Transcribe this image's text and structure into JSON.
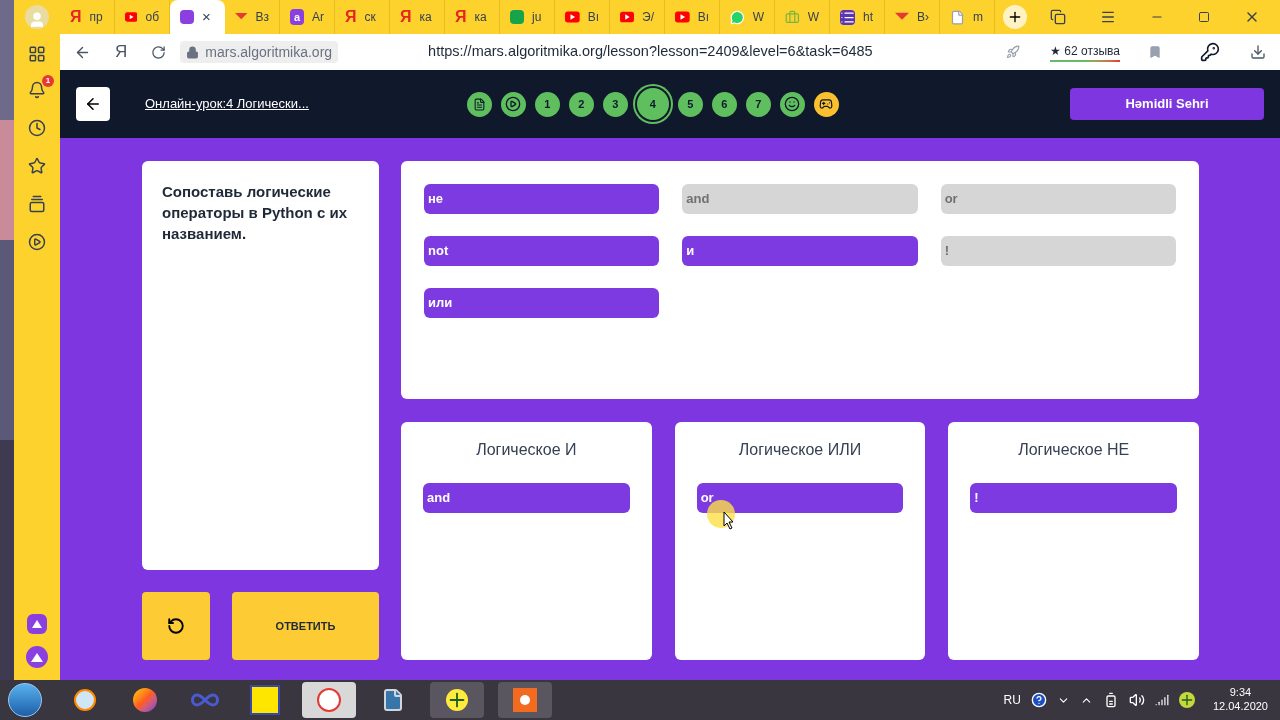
{
  "browser": {
    "tabs": [
      {
        "kind": "yandex",
        "glyph": "Я",
        "title": "пр",
        "selected": false
      },
      {
        "kind": "youtube",
        "title": "об",
        "selected": false
      },
      {
        "kind": "app",
        "selected": true,
        "close": "×"
      },
      {
        "kind": "mail",
        "title": "Вз",
        "selected": false
      },
      {
        "kind": "letter",
        "letter": "a",
        "title": "Ar",
        "selected": false
      },
      {
        "kind": "yandex",
        "glyph": "Я",
        "title": "ск",
        "selected": false
      },
      {
        "kind": "yandex",
        "glyph": "Я",
        "title": "ка",
        "selected": false
      },
      {
        "kind": "yandex",
        "glyph": "Я",
        "title": "ка",
        "selected": false
      },
      {
        "kind": "sheet",
        "title": "ju",
        "selected": false
      },
      {
        "kind": "youtube",
        "title": "Вı",
        "selected": false
      },
      {
        "kind": "youtube",
        "title": "Э/",
        "selected": false
      },
      {
        "kind": "youtube",
        "title": "Вı",
        "selected": false
      },
      {
        "kind": "whatsapp",
        "title": "W",
        "selected": false
      },
      {
        "kind": "briefcase",
        "title": "W",
        "selected": false
      },
      {
        "kind": "list",
        "title": "ht",
        "selected": false
      },
      {
        "kind": "mail",
        "title": "В›",
        "selected": false
      },
      {
        "kind": "doc",
        "title": "m",
        "selected": false
      }
    ],
    "home_button": "Я",
    "domain": "mars.algoritmika.org",
    "url": "https://mars.algoritmika.org/lesson?lesson=2409&level=6&task=6485",
    "reviews": "★ 62 отзыва",
    "notification_count": "1"
  },
  "lesson": {
    "title": "Онлайн-урок:4 Логически...",
    "steps": [
      {
        "kind": "doc",
        "selected": false
      },
      {
        "kind": "play",
        "selected": false
      },
      {
        "kind": "number",
        "label": "1",
        "selected": false
      },
      {
        "kind": "number",
        "label": "2",
        "selected": false
      },
      {
        "kind": "number",
        "label": "3",
        "selected": false
      },
      {
        "kind": "number",
        "label": "4",
        "selected": true
      },
      {
        "kind": "number",
        "label": "5",
        "selected": false
      },
      {
        "kind": "number",
        "label": "6",
        "selected": false
      },
      {
        "kind": "number",
        "label": "7",
        "selected": false
      },
      {
        "kind": "smile",
        "selected": false
      },
      {
        "kind": "bonus",
        "selected": false
      }
    ],
    "user": "Həmidli Sehri"
  },
  "task": {
    "question": "Сопоставь логические операторы в Python с их названием.",
    "answer_button": "ОТВЕТИТЬ",
    "pool": [
      {
        "label": "не",
        "used": false
      },
      {
        "label": "and",
        "used": true
      },
      {
        "label": "or",
        "used": true
      },
      {
        "label": "not",
        "used": false
      },
      {
        "label": "и",
        "used": false
      },
      {
        "label": "!",
        "used": true
      },
      {
        "label": "или",
        "used": false
      }
    ],
    "bins": [
      {
        "title": "Логическое И",
        "items": [
          "and"
        ]
      },
      {
        "title": "Логическое ИЛИ",
        "items": [
          "or"
        ]
      },
      {
        "title": "Логическое НЕ",
        "items": [
          "!"
        ]
      }
    ]
  },
  "taskbar": {
    "language": "RU",
    "time": "9:34",
    "date": "12.04.2020"
  }
}
